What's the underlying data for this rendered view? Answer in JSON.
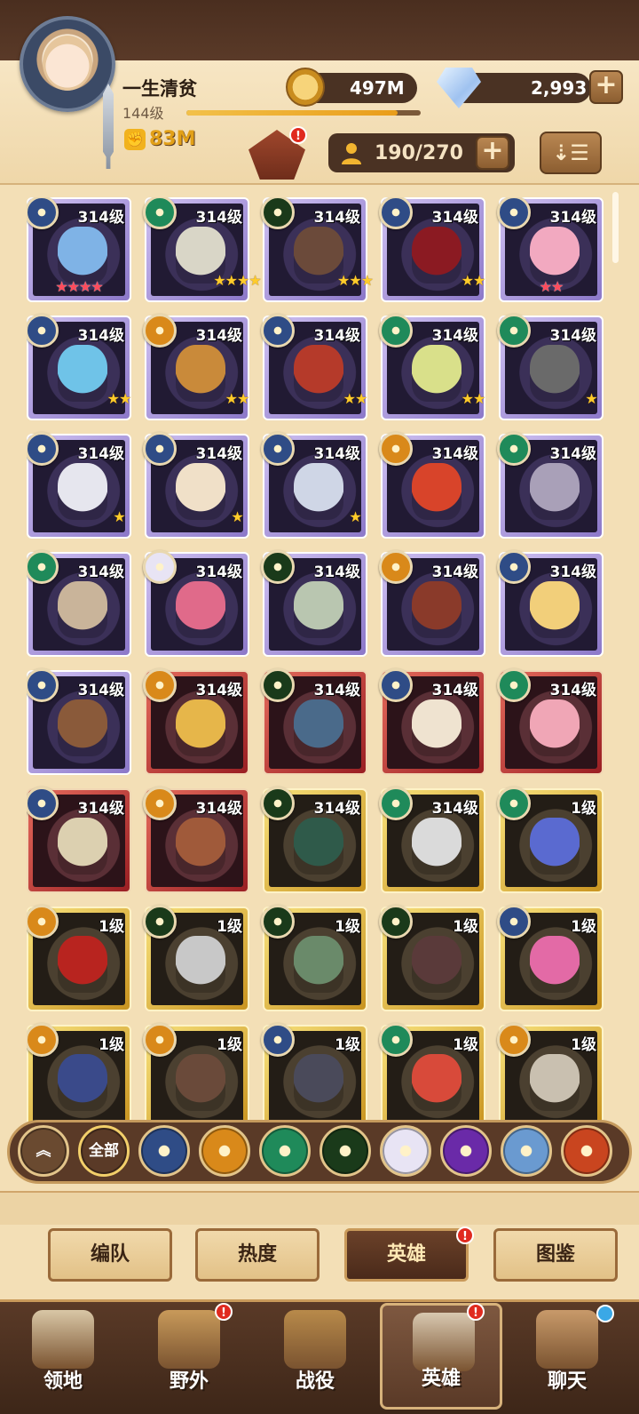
{
  "player": {
    "name": "一生清贫",
    "level": "144级",
    "power": "83M",
    "xp_progress": 0.9
  },
  "currency": {
    "gold": "497M",
    "gems": "2,993",
    "plus": "+"
  },
  "roster": {
    "count": "190/270",
    "plus": "+"
  },
  "notification": "!",
  "grid": {
    "cards": [
      {
        "level": "314级",
        "border": "purple",
        "faction": "lightbearer",
        "stars": "★★★★",
        "star_color": "red",
        "hero_color": "#7fb3e6"
      },
      {
        "level": "314级",
        "border": "purple",
        "faction": "wilder",
        "stars": "★★★★",
        "star_color": "gold",
        "hero_color": "#d9d6c7"
      },
      {
        "level": "314级",
        "border": "purple",
        "faction": "graveborn",
        "stars": "★★★",
        "star_color": "gold",
        "hero_color": "#6b4a3a"
      },
      {
        "level": "314级",
        "border": "purple",
        "faction": "lightbearer",
        "stars": "★★",
        "star_color": "gold",
        "hero_color": "#8b1a22"
      },
      {
        "level": "314级",
        "border": "purple",
        "faction": "lightbearer",
        "stars": "★★",
        "star_color": "red",
        "hero_color": "#f2a9c0"
      },
      {
        "level": "314级",
        "border": "purple",
        "faction": "lightbearer",
        "stars": "★★",
        "star_color": "gold",
        "hero_color": "#6fc3e8"
      },
      {
        "level": "314级",
        "border": "purple",
        "faction": "mauler",
        "stars": "★★",
        "star_color": "gold",
        "hero_color": "#c98a3a"
      },
      {
        "level": "314级",
        "border": "purple",
        "faction": "lightbearer",
        "stars": "★★",
        "star_color": "gold",
        "hero_color": "#b53a2a"
      },
      {
        "level": "314级",
        "border": "purple",
        "faction": "wilder",
        "stars": "★★",
        "star_color": "gold",
        "hero_color": "#d9e08a"
      },
      {
        "level": "314级",
        "border": "purple",
        "faction": "wilder",
        "stars": "★",
        "star_color": "gold",
        "hero_color": "#6a6a6a"
      },
      {
        "level": "314级",
        "border": "purple",
        "faction": "lightbearer",
        "stars": "★",
        "star_color": "gold",
        "hero_color": "#e6e6ee"
      },
      {
        "level": "314级",
        "border": "purple",
        "faction": "lightbearer",
        "stars": "★",
        "star_color": "gold",
        "hero_color": "#f0e0c8"
      },
      {
        "level": "314级",
        "border": "purple",
        "faction": "lightbearer",
        "stars": "★",
        "star_color": "gold",
        "hero_color": "#cfd6e6"
      },
      {
        "level": "314级",
        "border": "purple",
        "faction": "mauler",
        "stars": "",
        "star_color": "gold",
        "hero_color": "#d8442a"
      },
      {
        "level": "314级",
        "border": "purple",
        "faction": "wilder",
        "stars": "",
        "star_color": "gold",
        "hero_color": "#a9a0b8"
      },
      {
        "level": "314级",
        "border": "purple",
        "faction": "wilder",
        "stars": "",
        "star_color": "gold",
        "hero_color": "#c9b49a"
      },
      {
        "level": "314级",
        "border": "purple",
        "faction": "celestial",
        "stars": "",
        "star_color": "gold",
        "hero_color": "#e06a8a"
      },
      {
        "level": "314级",
        "border": "purple",
        "faction": "graveborn",
        "stars": "",
        "star_color": "gold",
        "hero_color": "#b9c6b0"
      },
      {
        "level": "314级",
        "border": "purple",
        "faction": "mauler",
        "stars": "",
        "star_color": "gold",
        "hero_color": "#8a3a2a"
      },
      {
        "level": "314级",
        "border": "purple",
        "faction": "lightbearer",
        "stars": "",
        "star_color": "gold",
        "hero_color": "#f2cf7a"
      },
      {
        "level": "314级",
        "border": "purple",
        "faction": "lightbearer",
        "stars": "",
        "star_color": "gold",
        "hero_color": "#8a5a3a"
      },
      {
        "level": "314级",
        "border": "red",
        "faction": "mauler",
        "stars": "",
        "star_color": "gold",
        "hero_color": "#e6b64a"
      },
      {
        "level": "314级",
        "border": "red",
        "faction": "graveborn",
        "stars": "",
        "star_color": "gold",
        "hero_color": "#4a6a8a"
      },
      {
        "level": "314级",
        "border": "red",
        "faction": "lightbearer",
        "stars": "",
        "star_color": "gold",
        "hero_color": "#efe3d0"
      },
      {
        "level": "314级",
        "border": "red",
        "faction": "wilder",
        "stars": "",
        "star_color": "gold",
        "hero_color": "#f0a6b6"
      },
      {
        "level": "314级",
        "border": "red",
        "faction": "lightbearer",
        "stars": "",
        "star_color": "gold",
        "hero_color": "#dcd0b0"
      },
      {
        "level": "314级",
        "border": "red",
        "faction": "mauler",
        "stars": "",
        "star_color": "gold",
        "hero_color": "#a05a3a"
      },
      {
        "level": "314级",
        "border": "gold",
        "faction": "graveborn",
        "stars": "",
        "star_color": "gold",
        "hero_color": "#2f5a4a"
      },
      {
        "level": "314级",
        "border": "gold",
        "faction": "wilder",
        "stars": "",
        "star_color": "gold",
        "hero_color": "#dadada"
      },
      {
        "level": "1级",
        "border": "gold",
        "faction": "wilder",
        "stars": "",
        "star_color": "gold",
        "hero_color": "#5a6ad0"
      },
      {
        "level": "1级",
        "border": "gold",
        "faction": "mauler",
        "stars": "",
        "star_color": "gold",
        "hero_color": "#b8241f"
      },
      {
        "level": "1级",
        "border": "gold",
        "faction": "graveborn",
        "stars": "",
        "star_color": "gold",
        "hero_color": "#c8c8c8"
      },
      {
        "level": "1级",
        "border": "gold",
        "faction": "graveborn",
        "stars": "",
        "star_color": "gold",
        "hero_color": "#6a8a6a"
      },
      {
        "level": "1级",
        "border": "gold",
        "faction": "graveborn",
        "stars": "",
        "star_color": "gold",
        "hero_color": "#5a3a3a"
      },
      {
        "level": "1级",
        "border": "gold",
        "faction": "lightbearer",
        "stars": "",
        "star_color": "gold",
        "hero_color": "#e36aa6"
      },
      {
        "level": "1级",
        "border": "gold",
        "faction": "mauler",
        "stars": "",
        "star_color": "gold",
        "hero_color": "#3a4a8a"
      },
      {
        "level": "1级",
        "border": "gold",
        "faction": "mauler",
        "stars": "",
        "star_color": "gold",
        "hero_color": "#6a4a3a"
      },
      {
        "level": "1级",
        "border": "gold",
        "faction": "lightbearer",
        "stars": "",
        "star_color": "gold",
        "hero_color": "#4a4a5a"
      },
      {
        "level": "1级",
        "border": "gold",
        "faction": "wilder",
        "stars": "",
        "star_color": "gold",
        "hero_color": "#d84a3a"
      },
      {
        "level": "1级",
        "border": "gold",
        "faction": "mauler",
        "stars": "",
        "star_color": "gold",
        "hero_color": "#c9c0b0"
      }
    ]
  },
  "faction_colors": {
    "lightbearer": "#2f4c86",
    "mauler": "#d9891a",
    "wilder": "#1f8a5a",
    "graveborn": "#1a3a1a",
    "celestial": "#e8e4f4",
    "hypogean": "#6a2aa8",
    "dimensional": "#6a9ad0",
    "draconis": "#c9451f"
  },
  "filters": {
    "collapse_icon": "chevron-up-icon",
    "all_label": "全部",
    "items": [
      "lightbearer",
      "mauler",
      "wilder",
      "graveborn",
      "celestial",
      "hypogean",
      "dimensional",
      "draconis"
    ]
  },
  "subtabs": [
    {
      "label": "编队",
      "active": false
    },
    {
      "label": "热度",
      "active": false
    },
    {
      "label": "英雄",
      "active": true,
      "badge": "!"
    },
    {
      "label": "图鉴",
      "active": false
    }
  ],
  "nav": [
    {
      "label": "领地",
      "active": false,
      "badge": ""
    },
    {
      "label": "野外",
      "active": false,
      "badge": "!"
    },
    {
      "label": "战役",
      "active": false,
      "badge": ""
    },
    {
      "label": "英雄",
      "active": true,
      "badge": "!"
    },
    {
      "label": "聊天",
      "active": false,
      "badge": "blue"
    }
  ]
}
